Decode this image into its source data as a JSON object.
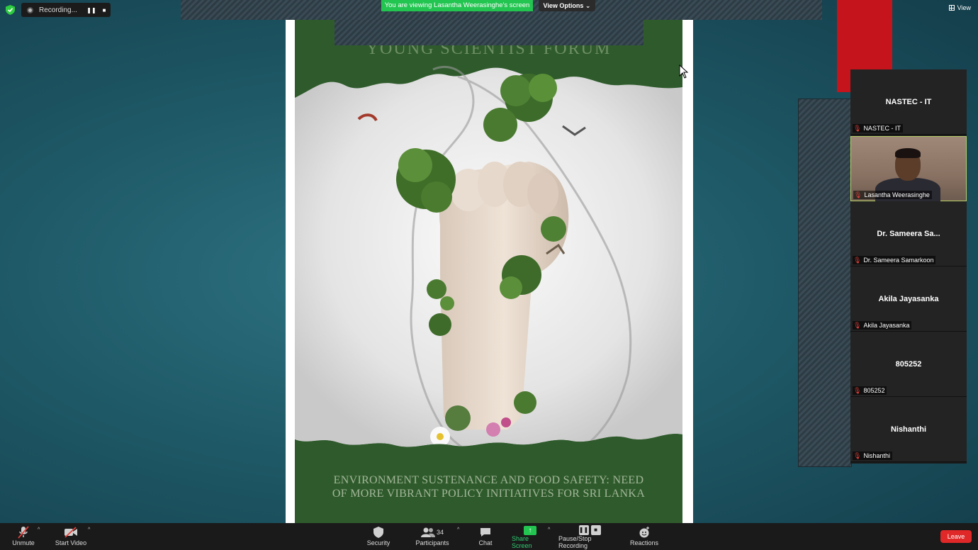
{
  "recording": {
    "label": "Recording...",
    "pause_glyph": "❚❚",
    "stop_glyph": "■"
  },
  "share_banner": {
    "text": "You are viewing Lasantha Weerasinghe's screen",
    "view_options": "View Options ⌄"
  },
  "view_button": {
    "label": "View",
    "icon": "grid-icon"
  },
  "shared_screen": {
    "header": "YOUNG SCIENTIST FORUM",
    "footer_line1": "ENVIRONMENT SUSTENANCE AND FOOD SAFETY: NEED",
    "footer_line2": "OF MORE VIBRANT POLICY INITIATIVES FOR SRI LANKA"
  },
  "participants_gallery": [
    {
      "title": "NASTEC - IT",
      "name": "NASTEC - IT",
      "video": false
    },
    {
      "title": "",
      "name": "Lasantha Weerasinghe",
      "video": true
    },
    {
      "title": "Dr. Sameera Sa...",
      "name": "Dr. Sameera Samarkoon",
      "video": false
    },
    {
      "title": "Akila Jayasanka",
      "name": "Akila Jayasanka",
      "video": false
    },
    {
      "title": "805252",
      "name": "805252",
      "video": false
    },
    {
      "title": "Nishanthi",
      "name": "Nishanthi",
      "video": false
    }
  ],
  "toolbar": {
    "unmute": "Unmute",
    "start_video": "Start Video",
    "security": "Security",
    "participants": "Participants",
    "participant_count": "34",
    "chat": "Chat",
    "share_screen": "Share Screen",
    "pause_stop_recording": "Pause/Stop Recording",
    "reactions": "Reactions",
    "leave": "Leave",
    "caret": "^"
  },
  "colors": {
    "accent_green": "#23c551",
    "leave_red": "#e02828",
    "toolbar_bg": "#1a1a1a",
    "poster_green": "#2f5b2c"
  }
}
